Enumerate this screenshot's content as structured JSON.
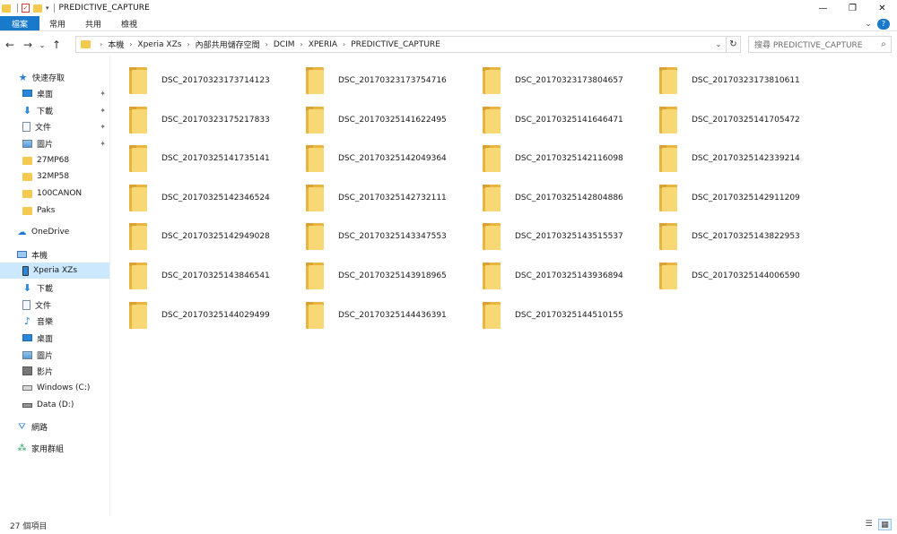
{
  "window": {
    "title": "PREDICTIVE_CAPTURE",
    "minimize": "—",
    "restore": "❐",
    "close": "✕"
  },
  "ribbon": {
    "tabs": [
      "檔案",
      "常用",
      "共用",
      "檢視"
    ],
    "expand": "⌄",
    "help": "?"
  },
  "nav": {
    "back": "←",
    "forward": "→",
    "recent": "⌄",
    "up": "↑"
  },
  "address": {
    "crumbs": [
      "本機",
      "Xperia XZs",
      "內部共用儲存空間",
      "DCIM",
      "XPERIA",
      "PREDICTIVE_CAPTURE"
    ],
    "dropdown": "⌄",
    "refresh": "↻"
  },
  "search": {
    "placeholder": "搜尋 PREDICTIVE_CAPTURE",
    "icon": "⌕"
  },
  "sidebar": {
    "quick_access": "快速存取",
    "qa_items": [
      "桌面",
      "下載",
      "文件",
      "圖片",
      "27MP68",
      "32MP58",
      "100CANON",
      "Paks"
    ],
    "onedrive": "OneDrive",
    "this_pc": "本機",
    "pc_items": [
      "Xperia XZs",
      "下載",
      "文件",
      "音樂",
      "桌面",
      "圖片",
      "影片",
      "Windows (C:)",
      "Data (D:)"
    ],
    "network": "網路",
    "homegroup": "家用群組",
    "pin": "📌"
  },
  "files": [
    "DSC_20170323173714123",
    "DSC_20170323173754716",
    "DSC_20170323173804657",
    "DSC_20170323173810611",
    "DSC_20170323175217833",
    "DSC_20170325141622495",
    "DSC_20170325141646471",
    "DSC_20170325141705472",
    "DSC_20170325141735141",
    "DSC_20170325142049364",
    "DSC_20170325142116098",
    "DSC_20170325142339214",
    "DSC_20170325142346524",
    "DSC_20170325142732111",
    "DSC_20170325142804886",
    "DSC_20170325142911209",
    "DSC_20170325142949028",
    "DSC_20170325143347553",
    "DSC_20170325143515537",
    "DSC_20170325143822953",
    "DSC_20170325143846541",
    "DSC_20170325143918965",
    "DSC_20170325143936894",
    "DSC_20170325144006590",
    "DSC_20170325144029499",
    "DSC_20170325144436391",
    "DSC_20170325144510155"
  ],
  "status": {
    "count": "27 個項目",
    "details_view": "☰",
    "icons_view": "▦"
  }
}
